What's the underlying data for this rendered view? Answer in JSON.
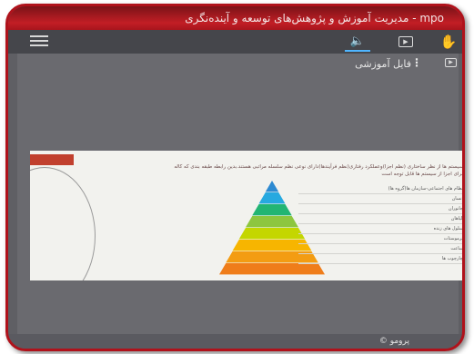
{
  "app": {
    "title": "مدیریت آموزش و پژوهش‌های توسعه و آینده‌نگری - mpo"
  },
  "toolbar": {
    "menu_icon": "hamburger-icon",
    "audio_icon": "speaker-icon",
    "video_icon": "video-icon",
    "hand_icon": "hand-icon"
  },
  "panel": {
    "title": "فایل آموزشی"
  },
  "slide": {
    "heading": "سیستم ها از نظر ساختاری (نظم اجزا)وعملکرد رفتاری(نظم فرآیندها)دارای نوعی نظم سلسله مراتبی هستند.بدین رابطه طبقه بندی که کاله برای اجزا از سیستم ها قابل توجه است",
    "pyramid_levels": [
      "",
      "",
      "",
      "",
      "",
      "",
      "",
      ""
    ],
    "list_items": [
      "نظام های اجتماعی-سازمان ها(گروه ها)",
      "انسان",
      "جانوران",
      "گیاهان",
      "سلول های زنده",
      "ترموستات",
      "ساعت",
      "چارچوب ها"
    ],
    "colors": [
      "#2d8ad1",
      "#26a9e0",
      "#22b573",
      "#8dc63f",
      "#c4d600",
      "#f7b500",
      "#f39c12",
      "#ef7d1a"
    ]
  },
  "footer": {
    "label": "© پرومو"
  }
}
